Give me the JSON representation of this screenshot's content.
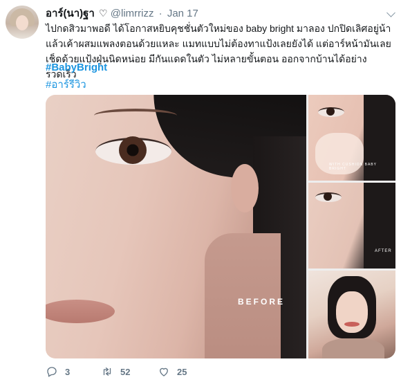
{
  "tweet": {
    "display_name": "อาร์(นา)ฐา",
    "handle": "@limrrizz",
    "separator": "·",
    "date": "Jan 17",
    "text": "ไปกดสิวมาพอดี ได้โอกาสหยิบคุชชั่นตัวใหม่ของ baby bright มาลอง ปกปิดเลิศอยู่น้า แล้วเค้าผสมแพลงตอนด้วยแหละ แมทแบบไม่ต้องทาแป้งเลยยังได้ แต่อาร์หน้ามันเลยเช็ดด้วยแป้งฝุ่นนิดหน่อย มีกันแดดในตัว ไม่หลายขั้นตอน ออกจากบ้านได้อย่างรวดเร็ว",
    "hashtags": [
      "#BabyBright",
      "#อาร์รีวิว"
    ]
  },
  "media": {
    "main_label": "BEFORE",
    "thumb1_caption": "WITH CUSHION BABY BRIGHT",
    "thumb2_caption": "AFTER"
  },
  "actions": {
    "reply_count": "3",
    "retweet_count": "52",
    "like_count": "25"
  },
  "icons": {
    "profile": "heart-outline-icon",
    "reply": "reply-bubble-icon",
    "retweet": "retweet-icon",
    "like": "heart-icon",
    "caret": "chevron-down-icon"
  },
  "colors": {
    "hashtag": "#1b95e0",
    "meta": "#657786",
    "text": "#14171a"
  }
}
